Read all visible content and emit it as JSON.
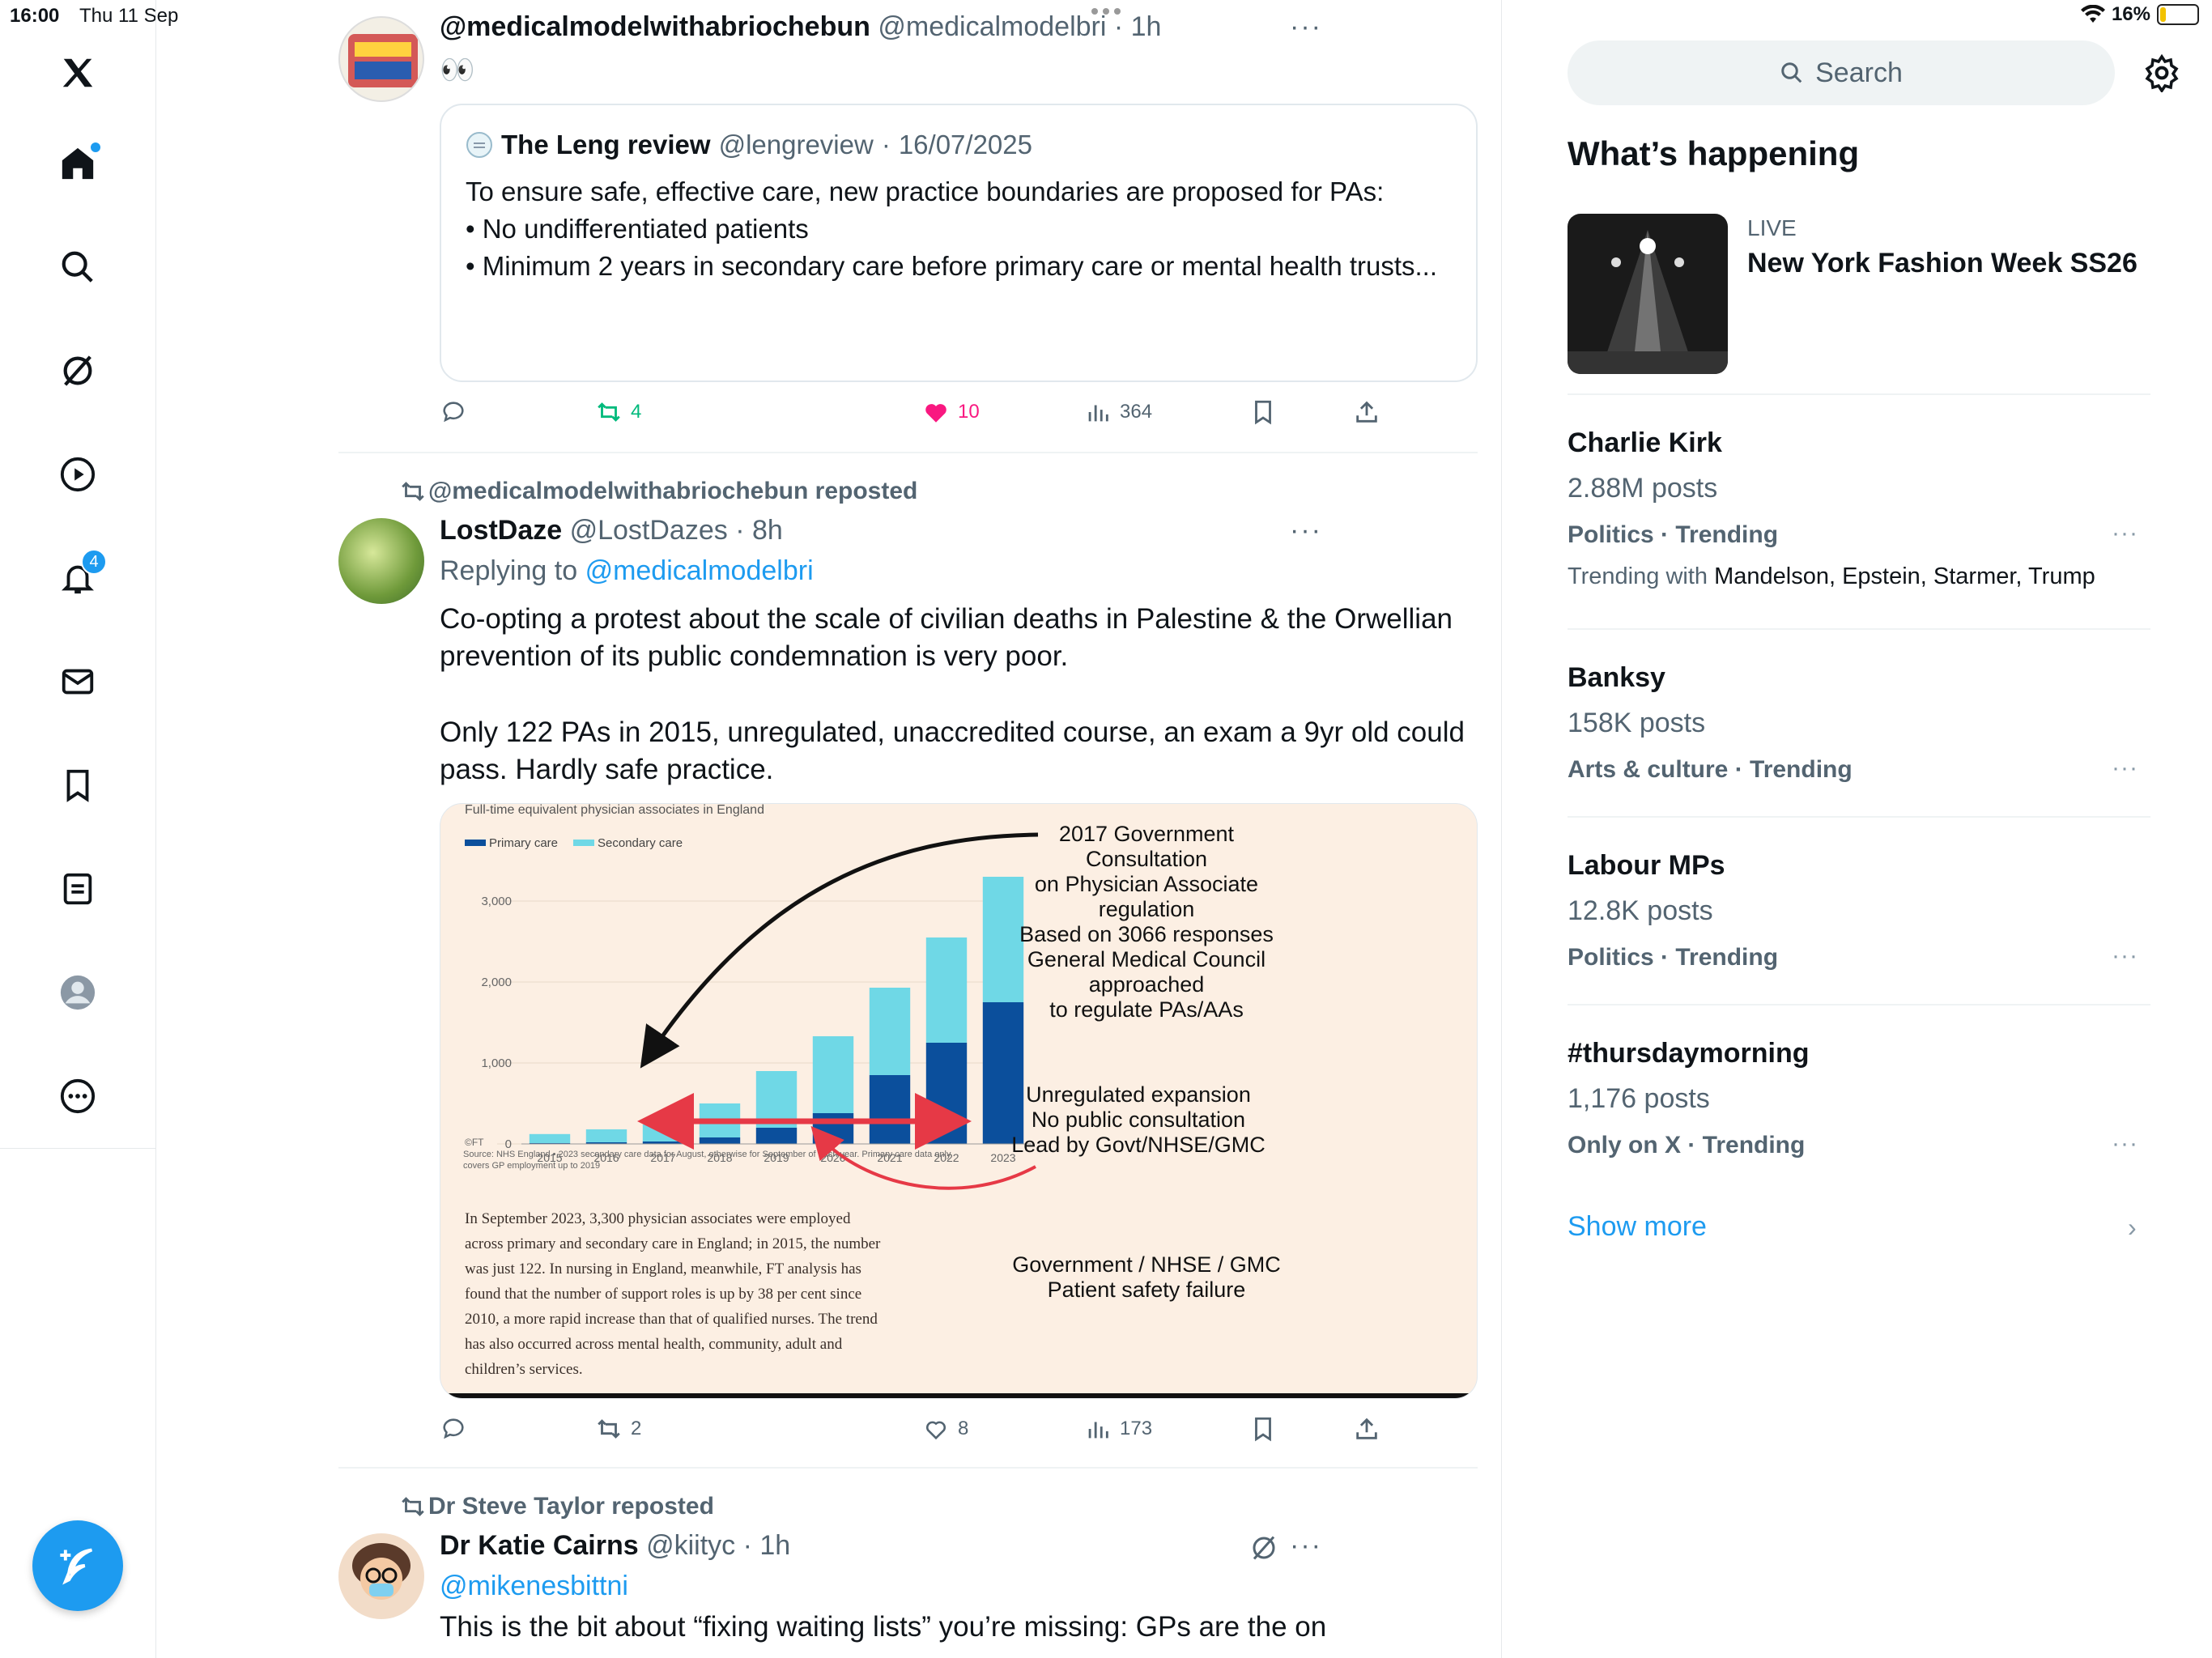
{
  "status_bar": {
    "time": "16:00",
    "date": "Thu 11 Sep",
    "battery": "16%",
    "battery_level": 0.16
  },
  "nav": {
    "notifications_badge": "4"
  },
  "tweets": [
    {
      "display_name": "@medicalmodelwithabriochebun",
      "handle": "@medicalmodelbri",
      "time": "1h",
      "text": "👀",
      "quote": {
        "name": "The Leng review",
        "handle": "@lengreview",
        "date": "16/07/2025",
        "text": "To ensure safe, effective care, new practice boundaries are proposed for PAs:\n• No undifferentiated patients\n• Minimum 2 years in secondary care before primary care or mental health trusts..."
      },
      "actions": {
        "reposts": "4",
        "likes": "10",
        "views": "364"
      }
    },
    {
      "repost_by": "@medicalmodelwithabriochebun reposted",
      "display_name": "LostDaze",
      "handle": "@LostDazes",
      "time": "8h",
      "replying_label": "Replying to",
      "replying_to": "@medicalmodelbri",
      "text_p1": "Co-opting a protest about the scale of civilian deaths in Palestine & the Orwellian prevention of its public condemnation is very poor.",
      "text_p2": "Only 122 PAs in 2015, unregulated, unaccredited course, an exam a 9yr old could pass. Hardly safe practice.",
      "actions": {
        "reposts": "2",
        "likes": "8",
        "views": "173"
      }
    },
    {
      "repost_by": "Dr Steve Taylor reposted",
      "display_name": "Dr Katie Cairns",
      "handle": "@kiityc",
      "time": "1h",
      "mention": "@mikenesbittni",
      "text": "This is the bit about “fixing waiting lists” you’re missing: GPs are the on"
    }
  ],
  "chart_data": {
    "type": "bar",
    "title": "Full-time equivalent physician associates in England",
    "categories": [
      "2015",
      "2016",
      "2017",
      "2018",
      "2019",
      "2020",
      "2021",
      "2022",
      "2023"
    ],
    "series": [
      {
        "name": "Primary care",
        "color": "#0b4f9c",
        "values": [
          10,
          20,
          30,
          80,
          200,
          380,
          850,
          1250,
          1750
        ]
      },
      {
        "name": "Secondary care",
        "color": "#6fd8e6",
        "values": [
          112,
          160,
          210,
          420,
          700,
          950,
          1080,
          1300,
          1550
        ]
      }
    ],
    "yticks": [
      "3,000",
      "2,000",
      "1,000",
      "0"
    ],
    "ylim": [
      0,
      3300
    ],
    "source": "Source: NHS England • 2023 secondary care data for August, otherwise for September of each year. Primary care data only covers GP employment up to 2019",
    "ft_mark": "©FT",
    "annotation_1": [
      "2017 Government",
      "Consultation",
      "on Physician Associate",
      "regulation",
      "Based on 3066 responses",
      "General Medical Council",
      "approached",
      "to regulate PAs/AAs"
    ],
    "annotation_2": [
      "Unregulated expansion",
      "No public consultation",
      "Lead by Govt/NHSE/GMC"
    ],
    "annotation_3": [
      "Government / NHSE / GMC",
      "Patient safety failure"
    ],
    "article_text": [
      "In September 2023, 3,300 physician associates were employed",
      "across primary and secondary care in England; in 2015, the number",
      "was just 122. In nursing in England, meanwhile, FT analysis has",
      "found that the number of support roles is up by 38 per cent since",
      "2010, a more rapid increase than that of qualified nurses. The trend",
      "has also occurred across mental health, community, adult and",
      "children’s services."
    ]
  },
  "sidebar": {
    "search_placeholder": "Search",
    "section_title": "What’s happening",
    "live": {
      "label": "LIVE",
      "title": "New York Fashion Week SS26"
    },
    "trends": [
      {
        "name": "Charlie Kirk",
        "count": "2.88M posts",
        "category": "Politics · Trending",
        "with_label": "Trending with",
        "with": "Mandelson, Epstein, Starmer, Trump"
      },
      {
        "name": "Banksy",
        "count": "158K posts",
        "category": "Arts & culture · Trending"
      },
      {
        "name": "Labour MPs",
        "count": "12.8K posts",
        "category": "Politics · Trending"
      },
      {
        "name": "#thursdaymorning",
        "count": "1,176 posts",
        "category": "Only on X · Trending"
      }
    ],
    "show_more": "Show more"
  }
}
